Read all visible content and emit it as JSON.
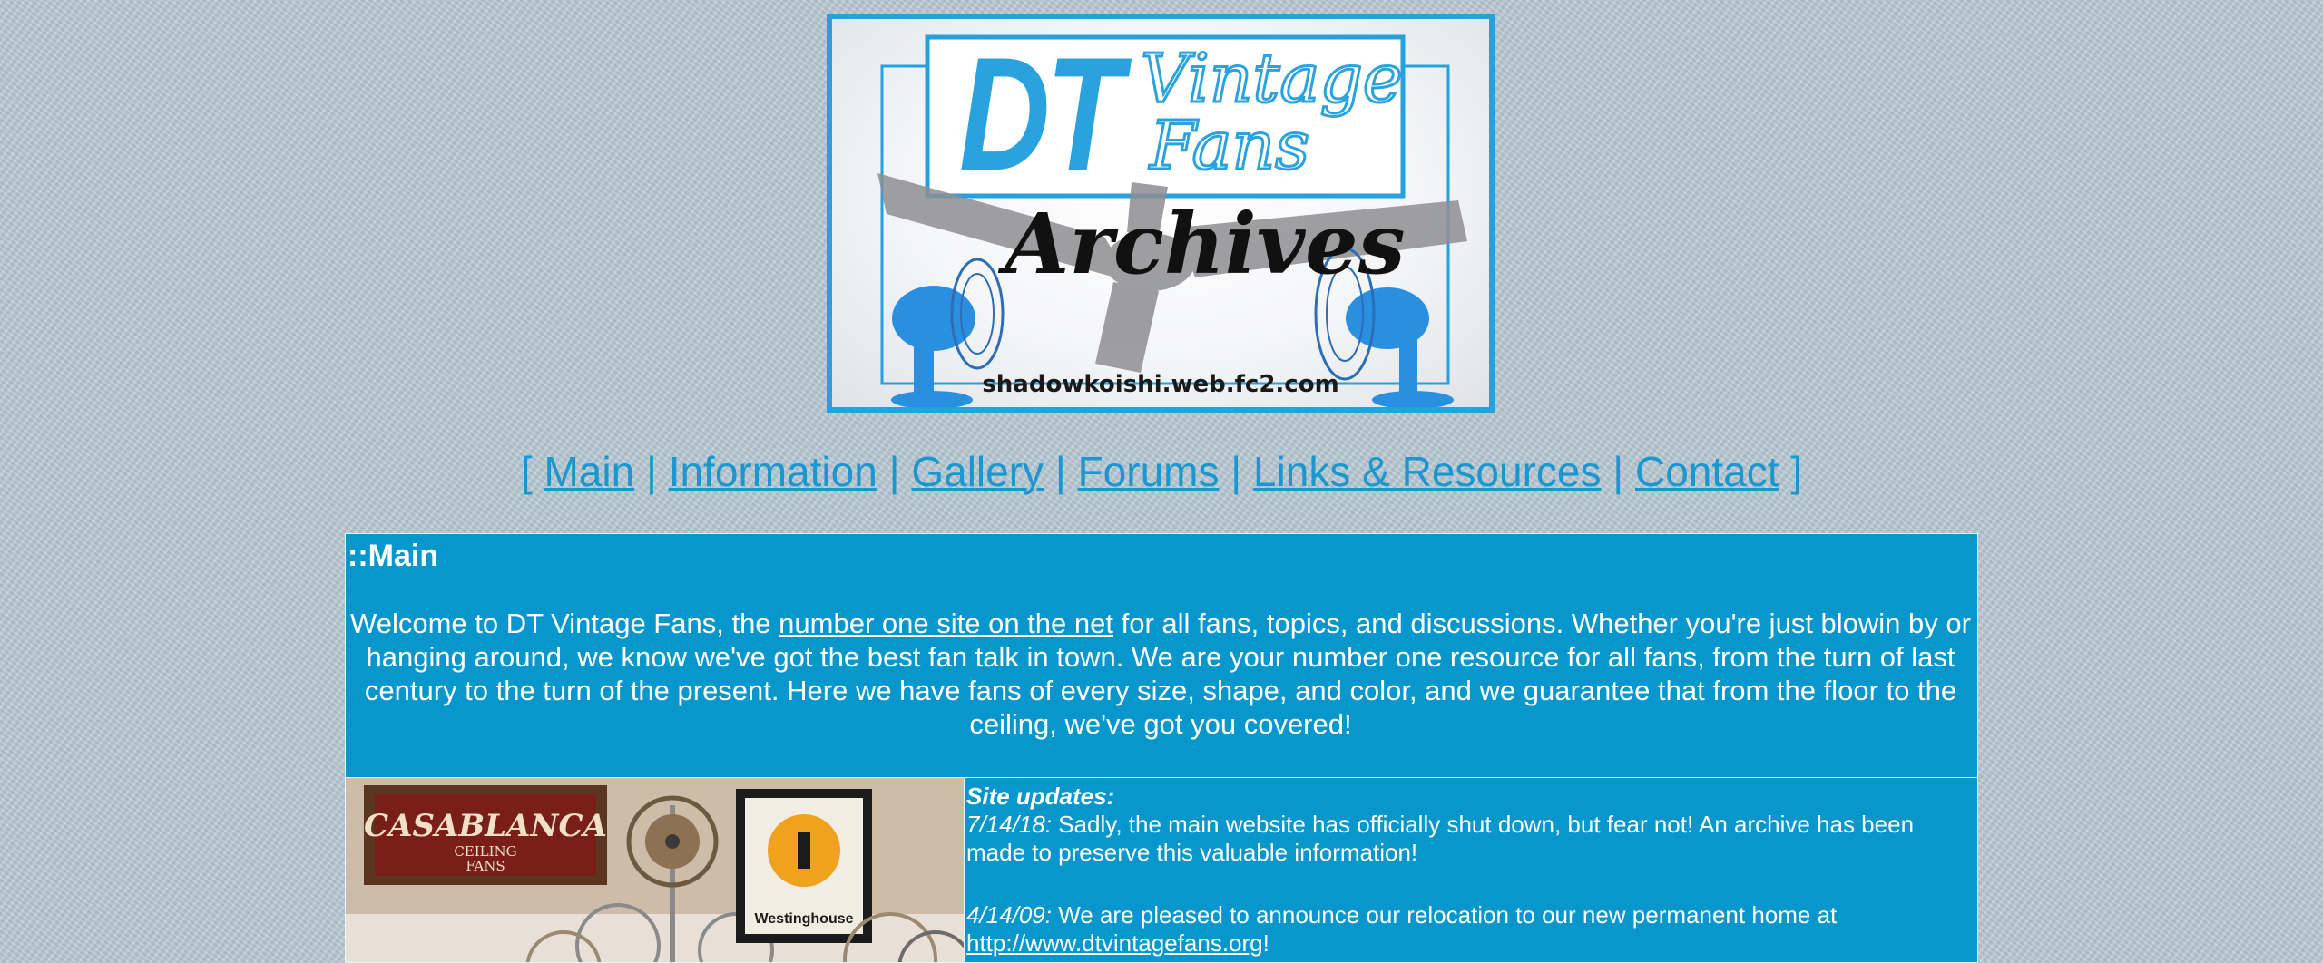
{
  "logo": {
    "line1": "DT",
    "line2a": "Vintage",
    "line2b": "Fans",
    "line3": "Archives",
    "url": "shadowkoishi.web.fc2.com",
    "accent_color": "#27a1dd"
  },
  "nav": {
    "open_bracket": "[",
    "close_bracket": "]",
    "separator": "|",
    "items": [
      {
        "label": "Main"
      },
      {
        "label": "Information"
      },
      {
        "label": "Gallery"
      },
      {
        "label": "Forums"
      },
      {
        "label": "Links & Resources"
      },
      {
        "label": "Contact"
      }
    ],
    "link_color": "#1b96cf"
  },
  "main": {
    "title": "::Main",
    "welcome_before": "Welcome to DT Vintage Fans, the ",
    "welcome_link": "number one site on the net",
    "welcome_after": " for all fans, topics, and discussions. Whether you're just blowin by or hanging around, we know we've got the best fan talk in town. We are your number one resource for all fans, from the turn of last century to the turn of the present. Here we have fans of every size, shape, and color, and we guarantee that from the floor to the ceiling, we've got you covered!",
    "panel_color": "#0897cc"
  },
  "photo": {
    "sign1_line1": "CASABLANCA",
    "sign1_line2": "CEILING",
    "sign1_line3": "FANS",
    "sign2": "Westinghouse"
  },
  "updates": {
    "header": "Site updates:",
    "entries": [
      {
        "date": "7/14/18:",
        "text": " Sadly, the main website has officially shut down, but fear not! An archive has been made to preserve this valuable information!"
      },
      {
        "date": "4/14/09:",
        "text": " We are pleased to announce our relocation to our new permanent home at ",
        "link": "http://www.dtvintagefans.org",
        "after": "!"
      }
    ]
  }
}
